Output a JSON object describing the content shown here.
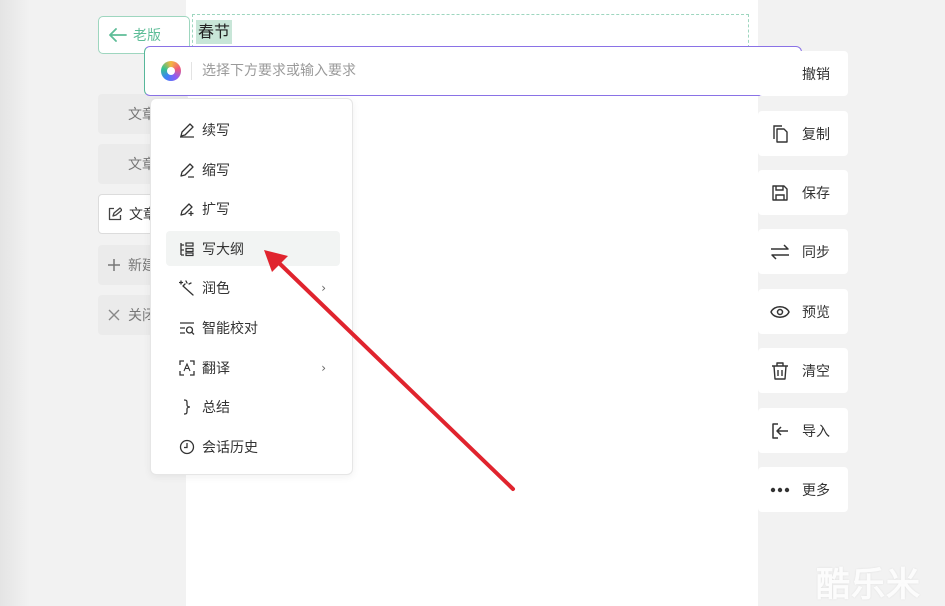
{
  "toolbar": {
    "old_version_label": "老版"
  },
  "left_panel": {
    "items": [
      {
        "label": "文章"
      },
      {
        "label": "文章"
      },
      {
        "label": "文章"
      },
      {
        "label": "新建"
      },
      {
        "label": "关闭"
      }
    ]
  },
  "document": {
    "selected_text": "春节"
  },
  "ai_input": {
    "placeholder": "选择下方要求或输入要求",
    "value": ""
  },
  "menu": {
    "items": [
      {
        "label": "续写",
        "icon": "pencil-icon"
      },
      {
        "label": "缩写",
        "icon": "pencil-icon"
      },
      {
        "label": "扩写",
        "icon": "pencil-plus-icon"
      },
      {
        "label": "写大纲",
        "icon": "outline-icon",
        "highlighted": true
      },
      {
        "label": "润色",
        "icon": "magic-wand-icon",
        "submenu_arrow": "›"
      },
      {
        "label": "智能校对",
        "icon": "proofread-icon"
      },
      {
        "label": "翻译",
        "icon": "translate-icon",
        "submenu_arrow": "›"
      },
      {
        "label": "总结",
        "icon": "brace-icon"
      },
      {
        "label": "会话历史",
        "icon": "clock-icon"
      }
    ]
  },
  "right_toolbar": {
    "items": [
      {
        "label": "撤销"
      },
      {
        "label": "复制",
        "icon": "copy-icon"
      },
      {
        "label": "保存",
        "icon": "save-icon"
      },
      {
        "label": "同步",
        "icon": "sync-icon"
      },
      {
        "label": "预览",
        "icon": "eye-icon"
      },
      {
        "label": "清空",
        "icon": "trash-icon"
      },
      {
        "label": "导入",
        "icon": "import-icon"
      },
      {
        "label": "更多",
        "icon": "more-icon"
      }
    ]
  },
  "annotation": {
    "color": "#e0242e"
  },
  "watermark": {
    "text": "酷乐米"
  }
}
